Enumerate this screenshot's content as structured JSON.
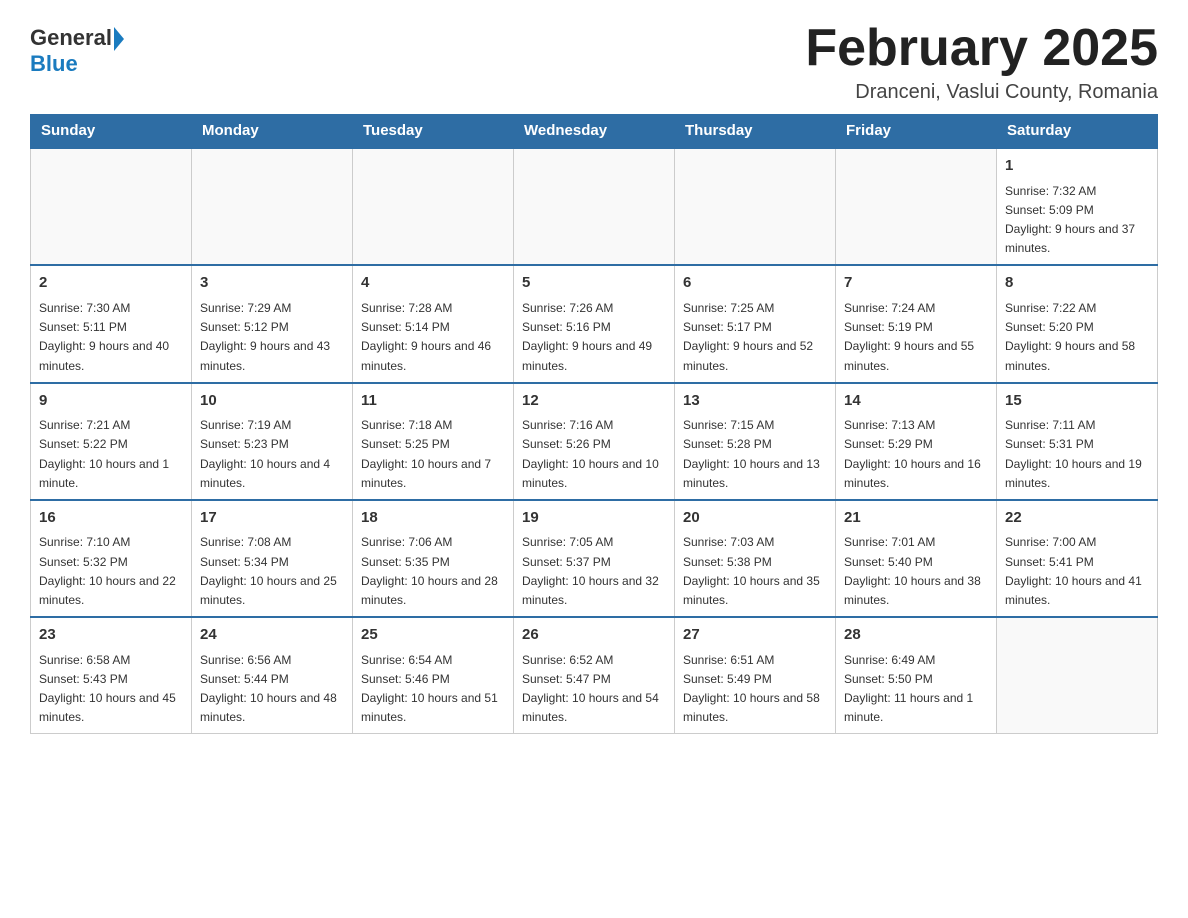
{
  "header": {
    "logo_general": "General",
    "logo_blue": "Blue",
    "month_title": "February 2025",
    "location": "Dranceni, Vaslui County, Romania"
  },
  "days_of_week": [
    "Sunday",
    "Monday",
    "Tuesday",
    "Wednesday",
    "Thursday",
    "Friday",
    "Saturday"
  ],
  "weeks": [
    [
      {
        "day": "",
        "info": ""
      },
      {
        "day": "",
        "info": ""
      },
      {
        "day": "",
        "info": ""
      },
      {
        "day": "",
        "info": ""
      },
      {
        "day": "",
        "info": ""
      },
      {
        "day": "",
        "info": ""
      },
      {
        "day": "1",
        "info": "Sunrise: 7:32 AM\nSunset: 5:09 PM\nDaylight: 9 hours and 37 minutes."
      }
    ],
    [
      {
        "day": "2",
        "info": "Sunrise: 7:30 AM\nSunset: 5:11 PM\nDaylight: 9 hours and 40 minutes."
      },
      {
        "day": "3",
        "info": "Sunrise: 7:29 AM\nSunset: 5:12 PM\nDaylight: 9 hours and 43 minutes."
      },
      {
        "day": "4",
        "info": "Sunrise: 7:28 AM\nSunset: 5:14 PM\nDaylight: 9 hours and 46 minutes."
      },
      {
        "day": "5",
        "info": "Sunrise: 7:26 AM\nSunset: 5:16 PM\nDaylight: 9 hours and 49 minutes."
      },
      {
        "day": "6",
        "info": "Sunrise: 7:25 AM\nSunset: 5:17 PM\nDaylight: 9 hours and 52 minutes."
      },
      {
        "day": "7",
        "info": "Sunrise: 7:24 AM\nSunset: 5:19 PM\nDaylight: 9 hours and 55 minutes."
      },
      {
        "day": "8",
        "info": "Sunrise: 7:22 AM\nSunset: 5:20 PM\nDaylight: 9 hours and 58 minutes."
      }
    ],
    [
      {
        "day": "9",
        "info": "Sunrise: 7:21 AM\nSunset: 5:22 PM\nDaylight: 10 hours and 1 minute."
      },
      {
        "day": "10",
        "info": "Sunrise: 7:19 AM\nSunset: 5:23 PM\nDaylight: 10 hours and 4 minutes."
      },
      {
        "day": "11",
        "info": "Sunrise: 7:18 AM\nSunset: 5:25 PM\nDaylight: 10 hours and 7 minutes."
      },
      {
        "day": "12",
        "info": "Sunrise: 7:16 AM\nSunset: 5:26 PM\nDaylight: 10 hours and 10 minutes."
      },
      {
        "day": "13",
        "info": "Sunrise: 7:15 AM\nSunset: 5:28 PM\nDaylight: 10 hours and 13 minutes."
      },
      {
        "day": "14",
        "info": "Sunrise: 7:13 AM\nSunset: 5:29 PM\nDaylight: 10 hours and 16 minutes."
      },
      {
        "day": "15",
        "info": "Sunrise: 7:11 AM\nSunset: 5:31 PM\nDaylight: 10 hours and 19 minutes."
      }
    ],
    [
      {
        "day": "16",
        "info": "Sunrise: 7:10 AM\nSunset: 5:32 PM\nDaylight: 10 hours and 22 minutes."
      },
      {
        "day": "17",
        "info": "Sunrise: 7:08 AM\nSunset: 5:34 PM\nDaylight: 10 hours and 25 minutes."
      },
      {
        "day": "18",
        "info": "Sunrise: 7:06 AM\nSunset: 5:35 PM\nDaylight: 10 hours and 28 minutes."
      },
      {
        "day": "19",
        "info": "Sunrise: 7:05 AM\nSunset: 5:37 PM\nDaylight: 10 hours and 32 minutes."
      },
      {
        "day": "20",
        "info": "Sunrise: 7:03 AM\nSunset: 5:38 PM\nDaylight: 10 hours and 35 minutes."
      },
      {
        "day": "21",
        "info": "Sunrise: 7:01 AM\nSunset: 5:40 PM\nDaylight: 10 hours and 38 minutes."
      },
      {
        "day": "22",
        "info": "Sunrise: 7:00 AM\nSunset: 5:41 PM\nDaylight: 10 hours and 41 minutes."
      }
    ],
    [
      {
        "day": "23",
        "info": "Sunrise: 6:58 AM\nSunset: 5:43 PM\nDaylight: 10 hours and 45 minutes."
      },
      {
        "day": "24",
        "info": "Sunrise: 6:56 AM\nSunset: 5:44 PM\nDaylight: 10 hours and 48 minutes."
      },
      {
        "day": "25",
        "info": "Sunrise: 6:54 AM\nSunset: 5:46 PM\nDaylight: 10 hours and 51 minutes."
      },
      {
        "day": "26",
        "info": "Sunrise: 6:52 AM\nSunset: 5:47 PM\nDaylight: 10 hours and 54 minutes."
      },
      {
        "day": "27",
        "info": "Sunrise: 6:51 AM\nSunset: 5:49 PM\nDaylight: 10 hours and 58 minutes."
      },
      {
        "day": "28",
        "info": "Sunrise: 6:49 AM\nSunset: 5:50 PM\nDaylight: 11 hours and 1 minute."
      },
      {
        "day": "",
        "info": ""
      }
    ]
  ]
}
